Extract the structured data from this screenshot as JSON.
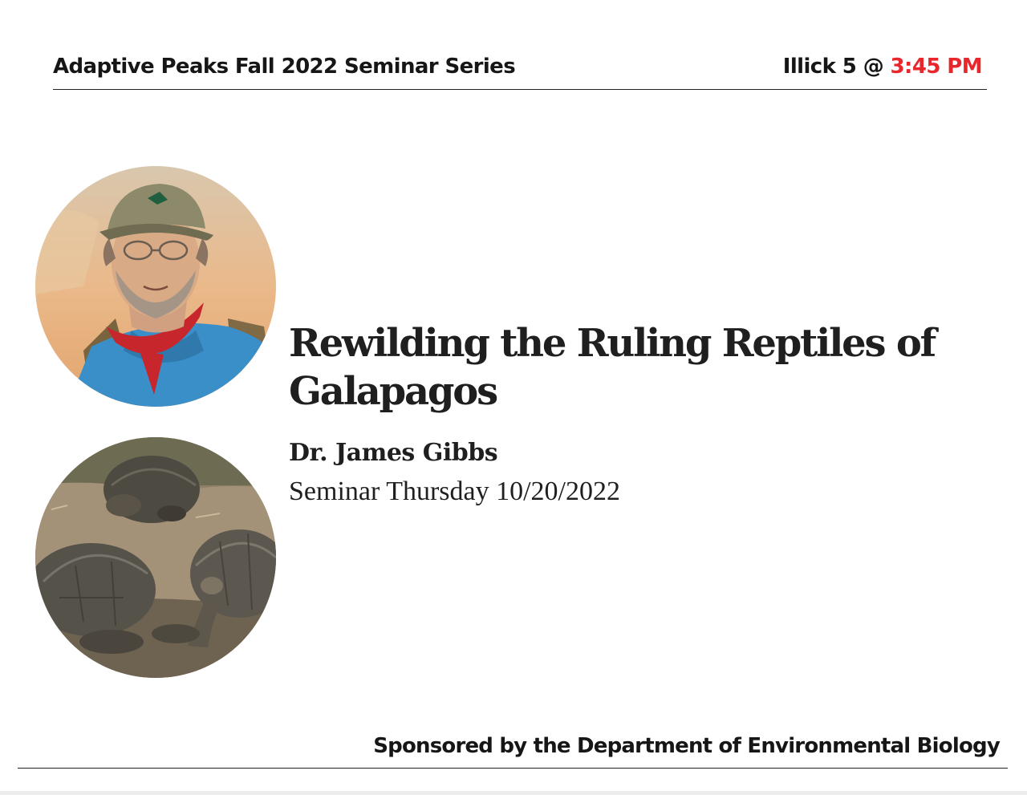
{
  "header": {
    "series_title": "Adaptive Peaks Fall 2022 Seminar Series",
    "location": "Illick 5 @ ",
    "time": "3:45 PM"
  },
  "talk": {
    "title": "Rewilding the Ruling Reptiles of Galapagos",
    "speaker": "Dr. James Gibbs",
    "date": "Seminar Thursday 10/20/2022"
  },
  "footer": {
    "sponsor": "Sponsored by the Department of Environmental Biology"
  },
  "colors": {
    "accent": "#e8262b",
    "text": "#1a1a1a"
  }
}
